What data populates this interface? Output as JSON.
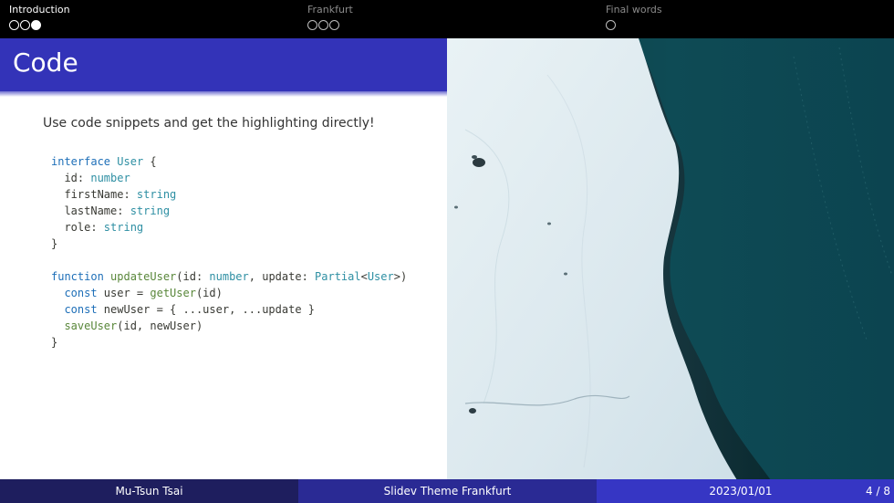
{
  "nav": {
    "sections": [
      {
        "title": "Introduction",
        "active": true
      },
      {
        "title": "Frankfurt",
        "active": false
      },
      {
        "title": "Final words",
        "active": false
      }
    ]
  },
  "slide": {
    "title": "Code",
    "description": "Use code snippets and get the highlighting directly!"
  },
  "code_lines": [
    "interface User {",
    "  id: number",
    "  firstName: string",
    "  lastName: string",
    "  role: string",
    "}",
    "",
    "function updateUser(id: number, update: Partial<User>)",
    "  const user = getUser(id)",
    "  const newUser = { ...user, ...update }",
    "  saveUser(id, newUser)",
    "}"
  ],
  "footer": {
    "author": "Mu-Tsun Tsai",
    "theme": "Slidev Theme Frankfurt",
    "date": "2023/01/01",
    "page": "4 / 8"
  },
  "colors": {
    "accent": "#3333b8",
    "nav_bg": "#000000",
    "footer_dark": "#1e1e5e",
    "footer_mid": "#2a2a94",
    "footer_light": "#3636c4"
  }
}
